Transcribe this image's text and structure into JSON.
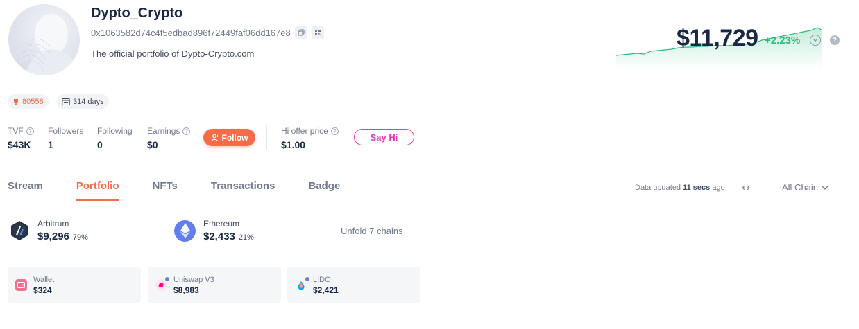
{
  "profile": {
    "username": "Dypto_Crypto",
    "address": "0x1063582d74c4f5edbad896f72449faf06dd167e8",
    "bio": "The official portfolio of Dypto-Crypto.com",
    "copy_icon": "copy-icon",
    "qr_icon": "qr-code-icon"
  },
  "net_worth": {
    "value": "$11,729",
    "change": "+2.23%",
    "change_color": "#2abb7f"
  },
  "badges": {
    "rank": "80558",
    "rank_icon": "trophy-icon",
    "days": "314 days",
    "days_icon": "calendar-icon"
  },
  "stats": {
    "tvf_label": "TVF",
    "tvf_value": "$43K",
    "followers_label": "Followers",
    "followers_value": "1",
    "following_label": "Following",
    "following_value": "0",
    "earnings_label": "Earnings",
    "earnings_value": "$0",
    "follow_label": "Follow",
    "hi_offer_label": "Hi offer price",
    "hi_offer_value": "$1.00",
    "say_hi_label": "Say Hi"
  },
  "tabs": [
    {
      "label": "Stream"
    },
    {
      "label": "Portfolio",
      "active": true
    },
    {
      "label": "NFTs"
    },
    {
      "label": "Transactions"
    },
    {
      "label": "Badge"
    }
  ],
  "data_update": {
    "prefix": "Data updated",
    "time": "11 secs",
    "suffix": "ago",
    "chain_filter": "All Chain"
  },
  "chains": [
    {
      "name": "Arbitrum",
      "value": "$9,296",
      "percent": "79%",
      "icon": "arbitrum-icon"
    },
    {
      "name": "Ethereum",
      "value": "$2,433",
      "percent": "21%",
      "icon": "ethereum-icon"
    }
  ],
  "unfold_label": "Unfold 7 chains",
  "protocols": [
    {
      "name": "Wallet",
      "value": "$324",
      "icon": "wallet-icon"
    },
    {
      "name": "Uniswap V3",
      "value": "$8,983",
      "icon": "uniswap-icon"
    },
    {
      "name": "LIDO",
      "value": "$2,421",
      "icon": "lido-icon"
    }
  ],
  "colors": {
    "accent": "#f46d48",
    "say_hi": "#e538b9",
    "positive": "#2abb7f"
  }
}
